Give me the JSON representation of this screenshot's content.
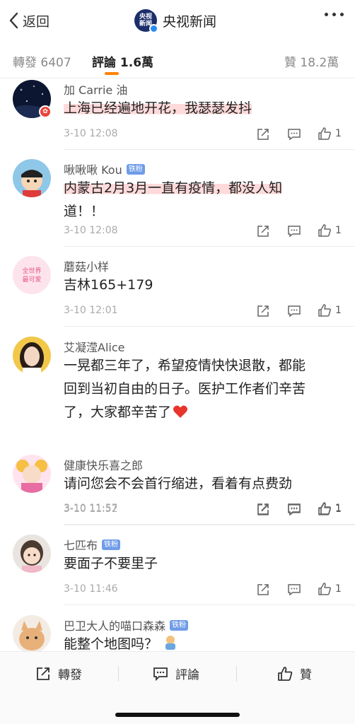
{
  "nav": {
    "back_label": "返回",
    "logo_text": "央视新闻",
    "title": "央视新闻"
  },
  "tabs": [
    {
      "label": "轉發 6407"
    },
    {
      "label": "評論 1.6萬"
    },
    {
      "label": "贊 18.2萬"
    }
  ],
  "colors": {
    "accent": "#ff8200",
    "highlight": "#ffb3b3",
    "fan_badge": "#6f9ce8"
  },
  "comments": [
    {
      "name": "加 Carrie 油",
      "text_lines": [
        "上海已经遍地开花，我瑟瑟发抖"
      ],
      "time": "3-10 12:08",
      "likes": "1"
    },
    {
      "name": "啾啾啾 Kou",
      "badge": "铁粉",
      "text_lines": [
        "内蒙古2月3月一直有疫情，都没人知",
        "道！！"
      ],
      "time": "3-10 12:08",
      "likes": "1"
    },
    {
      "name": "蘑菇小样",
      "text_lines": [
        "吉林165+179"
      ],
      "time": "3-10 12:01",
      "likes": "1"
    },
    {
      "name": "艾凝滢Alice",
      "text_lines": [
        "一晃都三年了，希望疫情快快退散，都能",
        "回到当初自由的日子。医护工作者们辛苦",
        "了，大家都辛苦了"
      ],
      "emoji": "red-heart-icon",
      "time": "3-10 11:57",
      "likes": "1"
    },
    {
      "name": "健康快乐喜之郎",
      "text_lines": [
        "请问您会不会首行缩进，看着有点费劲"
      ],
      "time": "3-10 11:52",
      "likes": "1"
    },
    {
      "name": "七匹布",
      "badge": "铁粉",
      "text_lines": [
        "要面子不要里子"
      ],
      "time": "3-10 11:46",
      "likes": "1"
    },
    {
      "name": "巴卫大人的喵口森森",
      "badge": "铁粉",
      "text_lines": [
        "能整个地图吗？"
      ],
      "emoji": "doge-emoji-icon"
    }
  ],
  "bottom": {
    "repost_label": "轉發",
    "comment_label": "評論",
    "like_label": "贊"
  }
}
